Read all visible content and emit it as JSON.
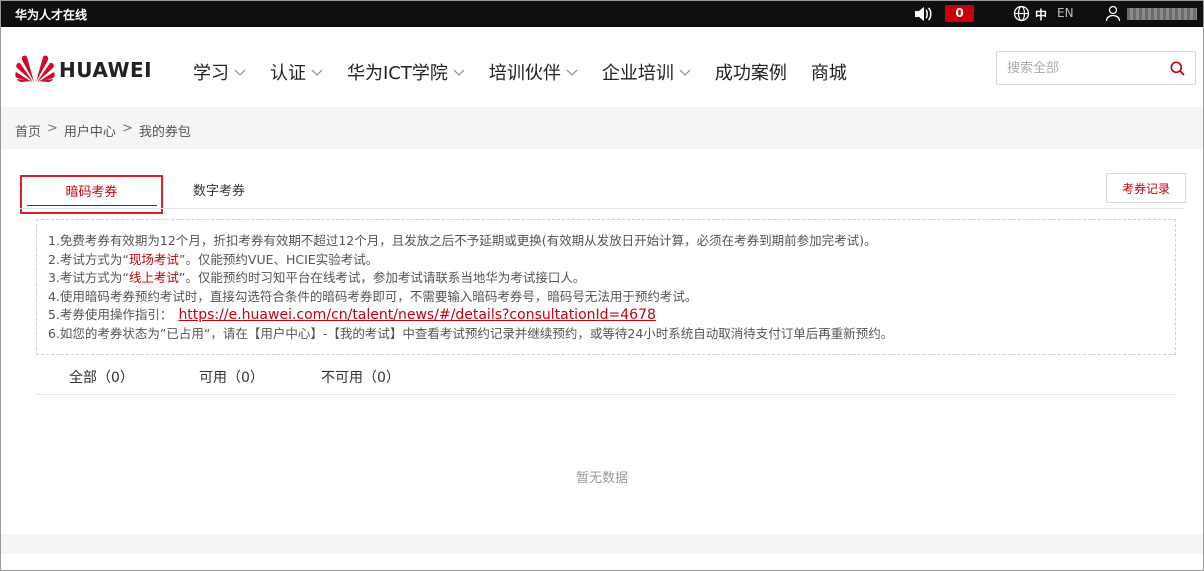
{
  "topbar": {
    "site_name": "华为人才在线",
    "notification_count": "0",
    "lang_zh": "中",
    "lang_en": "EN"
  },
  "header": {
    "brand": "HUAWEI",
    "nav": [
      {
        "label": "学习",
        "dropdown": true
      },
      {
        "label": "认证",
        "dropdown": true
      },
      {
        "label": "华为ICT学院",
        "dropdown": true
      },
      {
        "label": "培训伙伴",
        "dropdown": true
      },
      {
        "label": "企业培训",
        "dropdown": true
      },
      {
        "label": "成功案例",
        "dropdown": false
      },
      {
        "label": "商城",
        "dropdown": false
      }
    ],
    "search": {
      "placeholder": "搜索全部",
      "value": ""
    }
  },
  "breadcrumb": [
    "首页",
    "用户中心",
    "我的券包"
  ],
  "breadcrumb_sep": ">",
  "tabs": {
    "active": "暗码考券",
    "other": "数字考券"
  },
  "record_button": "考券记录",
  "notice": {
    "line1": "1.免费考券有效期为12个月，折扣考券有效期不超过12个月，且发放之后不予延期或更换(有效期从发放日开始计算，必须在考券到期前参加完考试)。",
    "line2_pre": "2.考试方式为“",
    "line2_hl": "现场考试",
    "line2_post": "”。仅能预约VUE、HCIE实验考试。",
    "line3_pre": "3.考试方式为“",
    "line3_hl": "线上考试",
    "line3_post": "”。仅能预约时习知平台在线考试，参加考试请联系当地华为考试接口人。",
    "line4": "4.使用暗码考券预约考试时，直接勾选符合条件的暗码考券即可，不需要输入暗码考券号，暗码号无法用于预约考试。",
    "line5_pre": "5.考券使用操作指引：",
    "line5_link": "https://e.huawei.com/cn/talent/news/#/details?consultationId=4678",
    "line6": "6.如您的考券状态为”已占用“，请在【用户中心】-【我的考试】中查看考试预约记录并继续预约，或等待24小时系统自动取消待支付订单后再重新预约。"
  },
  "filters": [
    {
      "label": "全部（0）"
    },
    {
      "label": "可用（0）"
    },
    {
      "label": "不可用（0）"
    }
  ],
  "empty_text": "暂无数据",
  "colors": {
    "accent": "#c7000b",
    "topbar_bg": "#0f0f0f",
    "band_bg": "#f5f5f5"
  }
}
